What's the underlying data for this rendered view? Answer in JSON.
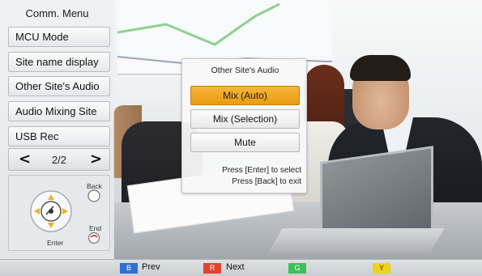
{
  "menu": {
    "title": "Comm. Menu",
    "items": [
      {
        "label": "MCU Mode"
      },
      {
        "label": "Site name display"
      },
      {
        "label": "Other Site's Audio"
      },
      {
        "label": "Audio Mixing Site"
      },
      {
        "label": "USB Rec"
      }
    ],
    "pager": {
      "prev": "<",
      "page": "2/2",
      "next": ">"
    }
  },
  "remote": {
    "back_label": "Back",
    "end_label": "End",
    "enter_label": "Enter"
  },
  "popup": {
    "title": "Other Site's Audio",
    "options": [
      {
        "label": "Mix (Auto)",
        "selected": true
      },
      {
        "label": "Mix (Selection)",
        "selected": false
      },
      {
        "label": "Mute",
        "selected": false
      }
    ],
    "hint_select": "Press [Enter] to select",
    "hint_exit": "Press [Back] to exit"
  },
  "bottom_bar": {
    "keys": [
      {
        "key": "B",
        "label": "Prev",
        "color": "#2f6fd0"
      },
      {
        "key": "R",
        "label": "Next",
        "color": "#e2432f"
      },
      {
        "key": "G",
        "label": "",
        "color": "#3fbf5a"
      },
      {
        "key": "Y",
        "label": "",
        "color": "#f0d21c"
      }
    ]
  },
  "colors": {
    "selected_option": "#f0a825",
    "menu_background": "#e8ebed"
  }
}
